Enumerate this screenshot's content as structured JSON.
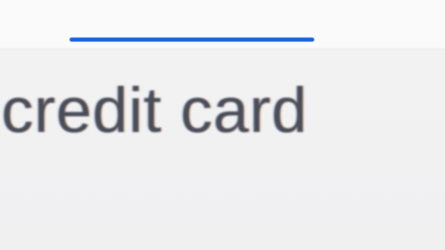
{
  "tab_indicator": {
    "color": "#1e63d8"
  },
  "results": {
    "items": [
      {
        "label": "credit card"
      }
    ]
  }
}
